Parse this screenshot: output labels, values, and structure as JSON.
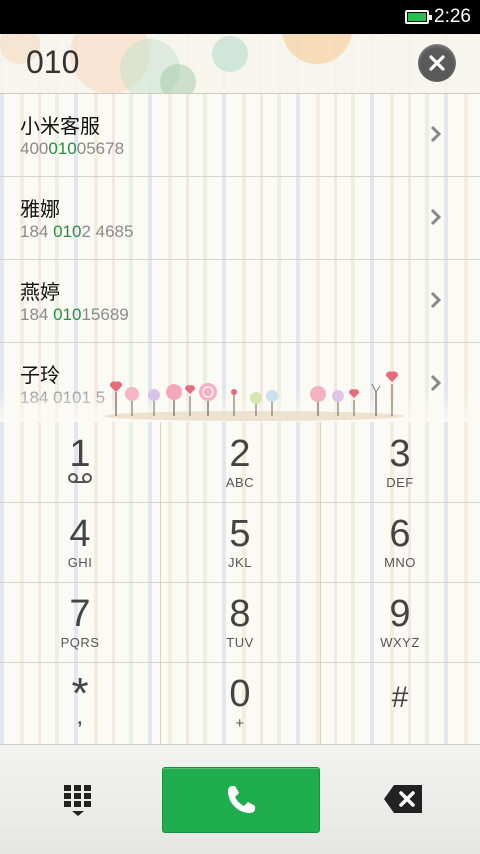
{
  "status_bar": {
    "time": "2:26",
    "battery_icon": "battery-full-icon",
    "battery_color": "#27c04f"
  },
  "dialer": {
    "number": "010",
    "clear_icon": "close-icon"
  },
  "results": [
    {
      "name": "小米客服",
      "number_pre": "400",
      "number_match": "010",
      "number_post": "05678"
    },
    {
      "name": "雅娜",
      "number_pre": "184 ",
      "number_match": "010",
      "number_post": "2 4685"
    },
    {
      "name": "燕婷",
      "number_pre": "184 ",
      "number_match": "010",
      "number_post": "15689"
    },
    {
      "name": "子玲",
      "number_pre": "184 ",
      "number_match": "010",
      "number_post": "1 5"
    }
  ],
  "keypad": [
    {
      "digit": "1",
      "letters": ""
    },
    {
      "digit": "2",
      "letters": "ABC"
    },
    {
      "digit": "3",
      "letters": "DEF"
    },
    {
      "digit": "4",
      "letters": "GHI"
    },
    {
      "digit": "5",
      "letters": "JKL"
    },
    {
      "digit": "6",
      "letters": "MNO"
    },
    {
      "digit": "7",
      "letters": "PQRS"
    },
    {
      "digit": "8",
      "letters": "TUV"
    },
    {
      "digit": "9",
      "letters": "WXYZ"
    },
    {
      "digit": "*",
      "letters": ","
    },
    {
      "digit": "0",
      "letters": "+"
    },
    {
      "digit": "#",
      "letters": ""
    }
  ],
  "bottom_bar": {
    "keypad_icon": "dialpad-icon",
    "call_icon": "phone-icon",
    "delete_icon": "backspace-icon",
    "call_color": "#1fad4e"
  }
}
